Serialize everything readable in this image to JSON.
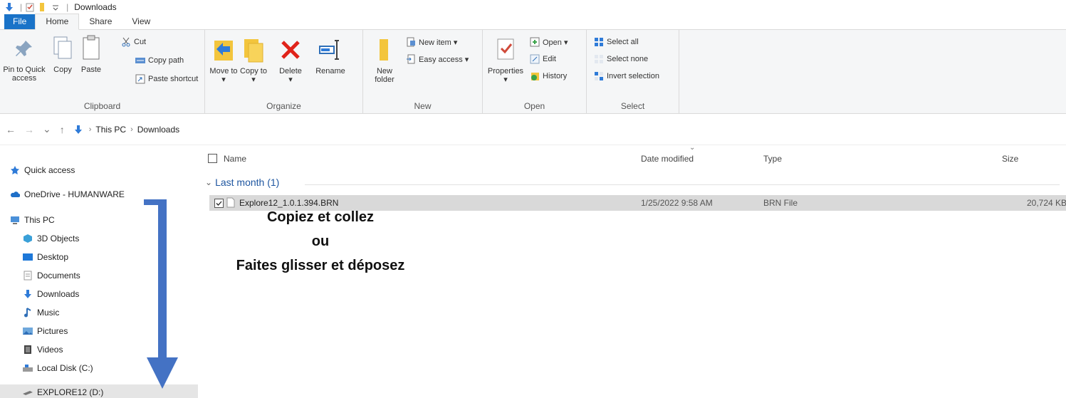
{
  "titlebar": {
    "title": "Downloads",
    "separator": "|"
  },
  "ribbon_tabs": [
    "File",
    "Home",
    "Share",
    "View"
  ],
  "ribbon": {
    "clipboard": {
      "label": "Clipboard",
      "pin": "Pin to Quick access",
      "copy": "Copy",
      "paste": "Paste",
      "cut": "Cut",
      "copy_path": "Copy path",
      "paste_shortcut": "Paste shortcut"
    },
    "organize": {
      "label": "Organize",
      "move_to": "Move to",
      "copy_to": "Copy to",
      "delete": "Delete",
      "rename": "Rename",
      "dropdown": "▾"
    },
    "new": {
      "label": "New",
      "new_folder": "New folder",
      "new_item": "New item ▾",
      "easy_access": "Easy access ▾"
    },
    "open": {
      "label": "Open",
      "properties": "Properties",
      "open": "Open ▾",
      "edit": "Edit",
      "history": "History"
    },
    "select": {
      "label": "Select",
      "select_all": "Select all",
      "select_none": "Select none",
      "invert_selection": "Invert selection"
    }
  },
  "address": {
    "back": "←",
    "forward": "→",
    "recent": "⌄",
    "up": "↑",
    "crumbs": [
      "This PC",
      "Downloads"
    ],
    "separator": "›"
  },
  "navigation": {
    "quick_access": "Quick access",
    "onedrive": "OneDrive - HUMANWARE",
    "this_pc": "This PC",
    "items": [
      "3D Objects",
      "Desktop",
      "Documents",
      "Downloads",
      "Music",
      "Pictures",
      "Videos",
      "Local Disk (C:)",
      "EXPLORE12 (D:)"
    ]
  },
  "filelist": {
    "columns": {
      "name": "Name",
      "date": "Date modified",
      "type": "Type",
      "size": "Size"
    },
    "group": "Last month (1)",
    "files": [
      {
        "name": "Explore12_1.0.1.394.BRN",
        "date": "1/25/2022 9:58 AM",
        "type": "BRN File",
        "size": "20,724 KB"
      }
    ]
  },
  "annotation": {
    "line1": "Copiez et collez",
    "line2": "ou",
    "line3": "Faites glisser et déposez"
  },
  "colors": {
    "accent": "#1a73c8",
    "arrow": "#4472c4",
    "group_header": "#1e56a0"
  }
}
